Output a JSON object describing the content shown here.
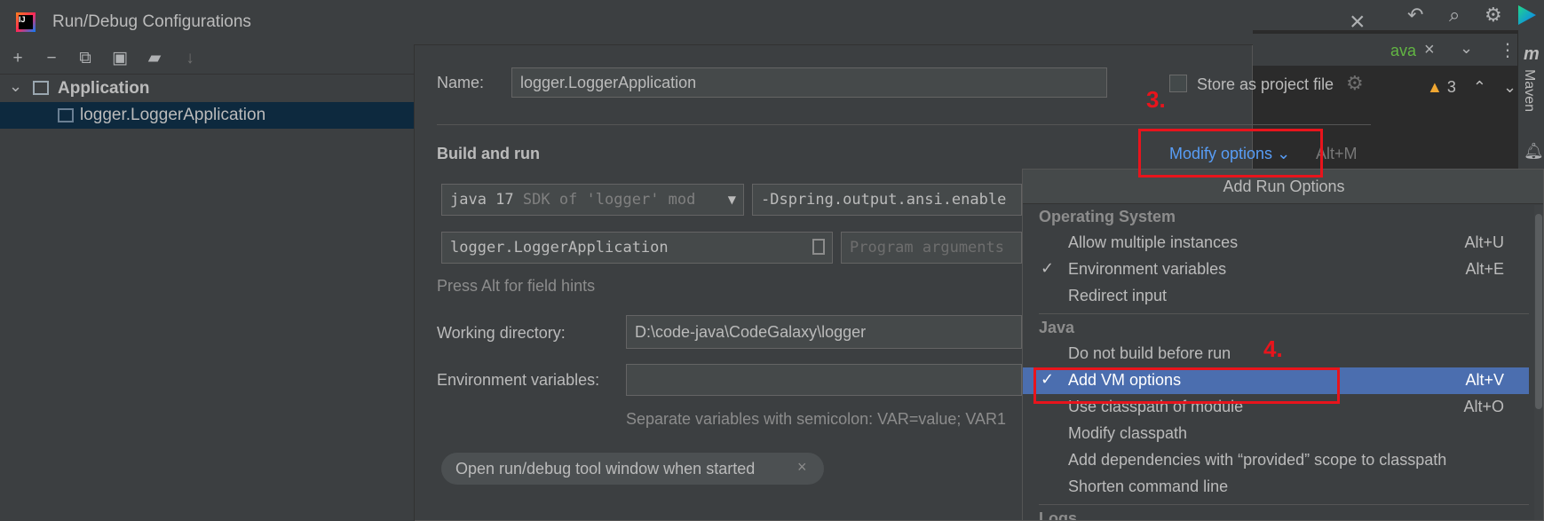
{
  "dialog": {
    "title": "Run/Debug Configurations",
    "close_icon": "close-icon",
    "toolbar_icons": [
      "add-icon",
      "remove-icon",
      "copy-icon",
      "save-icon",
      "folder-add-icon",
      "sort-icon"
    ]
  },
  "tree": {
    "group_label": "Application",
    "item_label": "logger.LoggerApplication"
  },
  "config": {
    "name_label": "Name:",
    "name_value": "logger.LoggerApplication",
    "store_label": "Store as project file",
    "section_title": "Build and run",
    "modify_options_label": "Modify options",
    "modify_options_shortcut": "Alt+M",
    "sdk_main": "java 17",
    "sdk_detail": "SDK of 'logger' mod",
    "vm_options_value": "-Dspring.output.ansi.enable",
    "main_class_value": "logger.LoggerApplication",
    "program_args_placeholder": "Program arguments",
    "hint_text": "Press Alt for field hints",
    "workdir_label": "Working directory:",
    "workdir_value": "D:\\code-java\\CodeGalaxy\\logger",
    "env_label": "Environment variables:",
    "env_hint": "Separate variables with semicolon: VAR=value; VAR1",
    "chip_label": "Open run/debug tool window when started"
  },
  "popup": {
    "title": "Add Run Options",
    "sections": [
      {
        "header": "Operating System"
      },
      {
        "header": "Java"
      },
      {
        "header": "Logs"
      }
    ],
    "items": [
      {
        "label": "Allow multiple instances",
        "shortcut": "Alt+U",
        "checked": false
      },
      {
        "label": "Environment variables",
        "shortcut": "Alt+E",
        "checked": true
      },
      {
        "label": "Redirect input",
        "shortcut": "",
        "checked": false
      },
      {
        "label": "Do not build before run",
        "shortcut": "",
        "checked": false
      },
      {
        "label": "Add VM options",
        "shortcut": "Alt+V",
        "checked": true,
        "selected": true
      },
      {
        "label": "Use classpath of module",
        "shortcut": "Alt+O",
        "checked": false
      },
      {
        "label": "Modify classpath",
        "shortcut": "",
        "checked": false
      },
      {
        "label": "Add dependencies with “provided” scope to classpath",
        "shortcut": "",
        "checked": false
      },
      {
        "label": "Shorten command line",
        "shortcut": "",
        "checked": false
      }
    ]
  },
  "annotations": {
    "step3": "3.",
    "step4": "4."
  },
  "ide_background": {
    "tab_fragment": "ava",
    "warning_count": "3",
    "maven_label": "Maven"
  },
  "colors": {
    "accent": "#4b6eaf",
    "link": "#589df6",
    "annotation_red": "#e8141c",
    "warning": "#f0a732"
  }
}
